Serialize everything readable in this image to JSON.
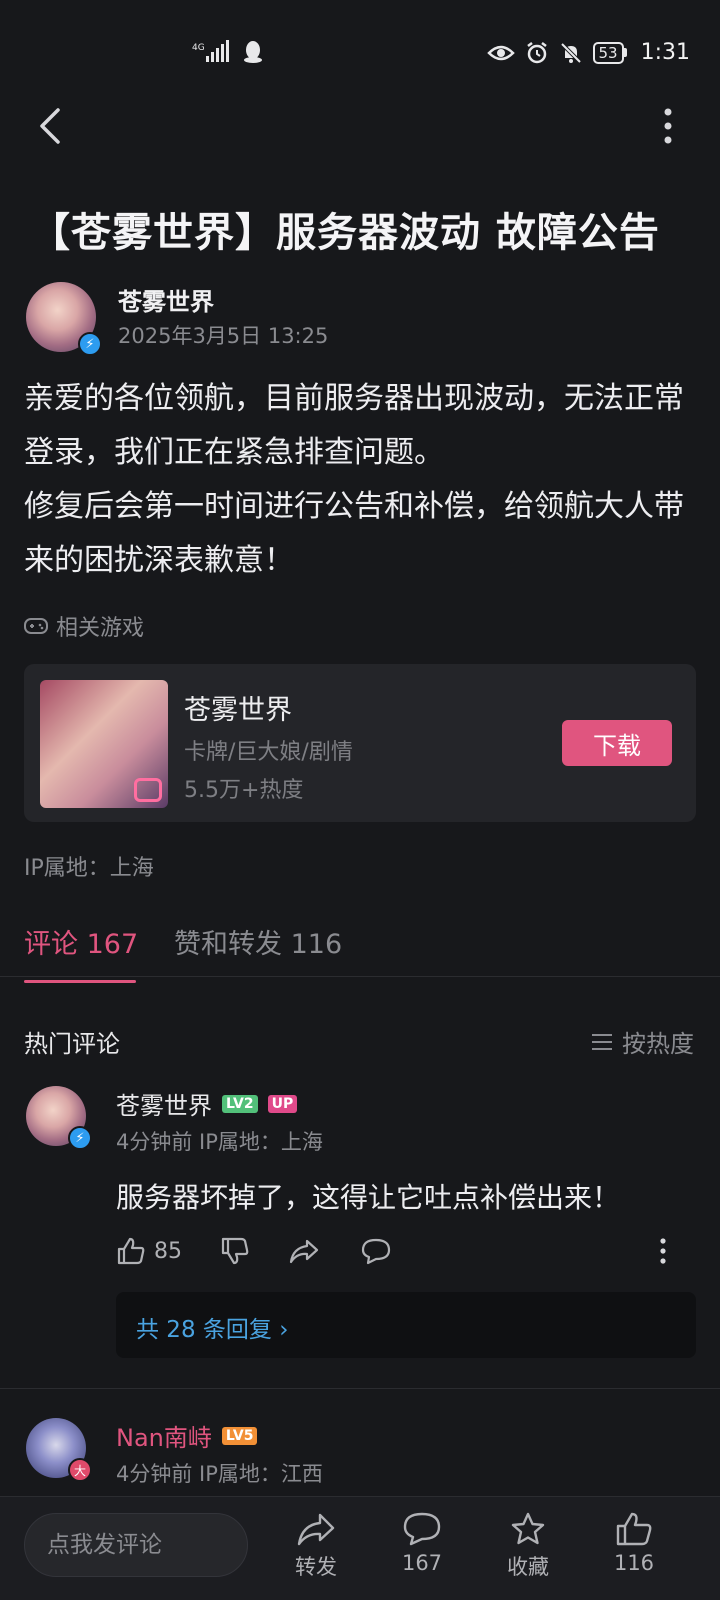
{
  "status_bar": {
    "network": "4G",
    "battery": "53",
    "time": "1:31"
  },
  "post": {
    "title": "【苍雾世界】服务器波动 故障公告",
    "author": "苍雾世界",
    "date": "2025年3月5日 13:25",
    "paragraphs": [
      "亲爱的各位领航，目前服务器出现波动，无法正常登录，我们正在紧急排查问题。",
      "修复后会第一时间进行公告和补偿，给领航大人带来的困扰深表歉意！"
    ],
    "related_label": "相关游戏",
    "game": {
      "name": "苍雾世界",
      "tags": "卡牌/巨大娘/剧情",
      "heat": "5.5万+热度",
      "download_label": "下载"
    },
    "ip": "IP属地：上海"
  },
  "tabs": {
    "comments": "评论 167",
    "likes_shares": "赞和转发 116"
  },
  "comments_section": {
    "hot_label": "热门评论",
    "sort_label": "按热度",
    "comments": [
      {
        "name": "苍雾世界",
        "level": "LV2",
        "up_badge": "UP",
        "meta": "4分钟前  IP属地：上海",
        "text": "服务器坏掉了，这得让它吐点补偿出来！",
        "likes": "85",
        "reply_summary": "共 28 条回复 ›"
      },
      {
        "name": "Nan南峙",
        "level": "LV5",
        "badge": "大",
        "meta": "4分钟前  IP属地：江西"
      }
    ]
  },
  "bottom_bar": {
    "comment_placeholder": "点我发评论",
    "share_label": "转发",
    "comment_count": "167",
    "favorite_label": "收藏",
    "like_count": "116"
  }
}
